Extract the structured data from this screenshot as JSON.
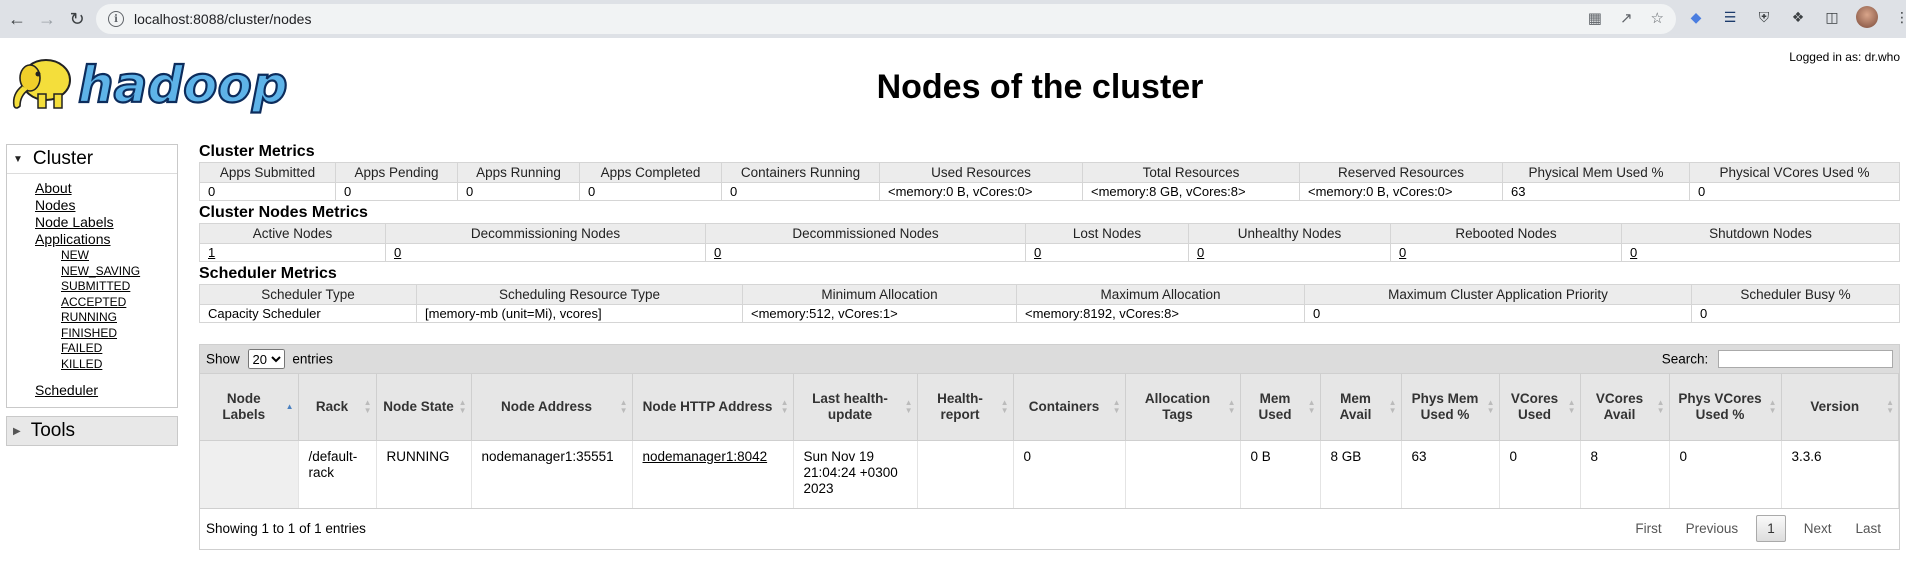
{
  "browser": {
    "url": "localhost:8088/cluster/nodes"
  },
  "header": {
    "logged_in": "Logged in as: dr.who",
    "title": "Nodes of the cluster",
    "logo_text": "hadoop"
  },
  "sidebar": {
    "cluster_label": "Cluster",
    "links": [
      "About",
      "Nodes",
      "Node Labels",
      "Applications"
    ],
    "app_states": [
      "NEW",
      "NEW_SAVING",
      "SUBMITTED",
      "ACCEPTED",
      "RUNNING",
      "FINISHED",
      "FAILED",
      "KILLED"
    ],
    "scheduler_link": "Scheduler",
    "tools_label": "Tools"
  },
  "cluster_metrics": {
    "title": "Cluster Metrics",
    "headers": [
      "Apps Submitted",
      "Apps Pending",
      "Apps Running",
      "Apps Completed",
      "Containers Running",
      "Used Resources",
      "Total Resources",
      "Reserved Resources",
      "Physical Mem Used %",
      "Physical VCores Used %"
    ],
    "values": [
      "0",
      "0",
      "0",
      "0",
      "0",
      "<memory:0 B, vCores:0>",
      "<memory:8 GB, vCores:8>",
      "<memory:0 B, vCores:0>",
      "63",
      "0"
    ]
  },
  "node_metrics": {
    "title": "Cluster Nodes Metrics",
    "headers": [
      "Active Nodes",
      "Decommissioning Nodes",
      "Decommissioned Nodes",
      "Lost Nodes",
      "Unhealthy Nodes",
      "Rebooted Nodes",
      "Shutdown Nodes"
    ],
    "values": [
      "1",
      "0",
      "0",
      "0",
      "0",
      "0",
      "0"
    ]
  },
  "scheduler_metrics": {
    "title": "Scheduler Metrics",
    "headers": [
      "Scheduler Type",
      "Scheduling Resource Type",
      "Minimum Allocation",
      "Maximum Allocation",
      "Maximum Cluster Application Priority",
      "Scheduler Busy %"
    ],
    "values": [
      "Capacity Scheduler",
      "[memory-mb (unit=Mi), vcores]",
      "<memory:512, vCores:1>",
      "<memory:8192, vCores:8>",
      "0",
      "0"
    ]
  },
  "table": {
    "show_label": "Show",
    "page_size": "20",
    "entries_label": "entries",
    "search_label": "Search:",
    "search_value": "",
    "columns": [
      "Node Labels",
      "Rack",
      "Node State",
      "Node Address",
      "Node HTTP Address",
      "Last health-update",
      "Health-report",
      "Containers",
      "Allocation Tags",
      "Mem Used",
      "Mem Avail",
      "Phys Mem Used %",
      "VCores Used",
      "VCores Avail",
      "Phys VCores Used %",
      "Version"
    ],
    "rows": [
      [
        "",
        "/default-rack",
        "RUNNING",
        "nodemanager1:35551",
        "nodemanager1:8042",
        "Sun Nov 19 21:04:24 +0300 2023",
        "",
        "0",
        "",
        "0 B",
        "8 GB",
        "63",
        "0",
        "8",
        "0",
        "3.3.6"
      ]
    ],
    "info": "Showing 1 to 1 of 1 entries",
    "pager": {
      "first": "First",
      "previous": "Previous",
      "current": "1",
      "next": "Next",
      "last": "Last"
    }
  }
}
